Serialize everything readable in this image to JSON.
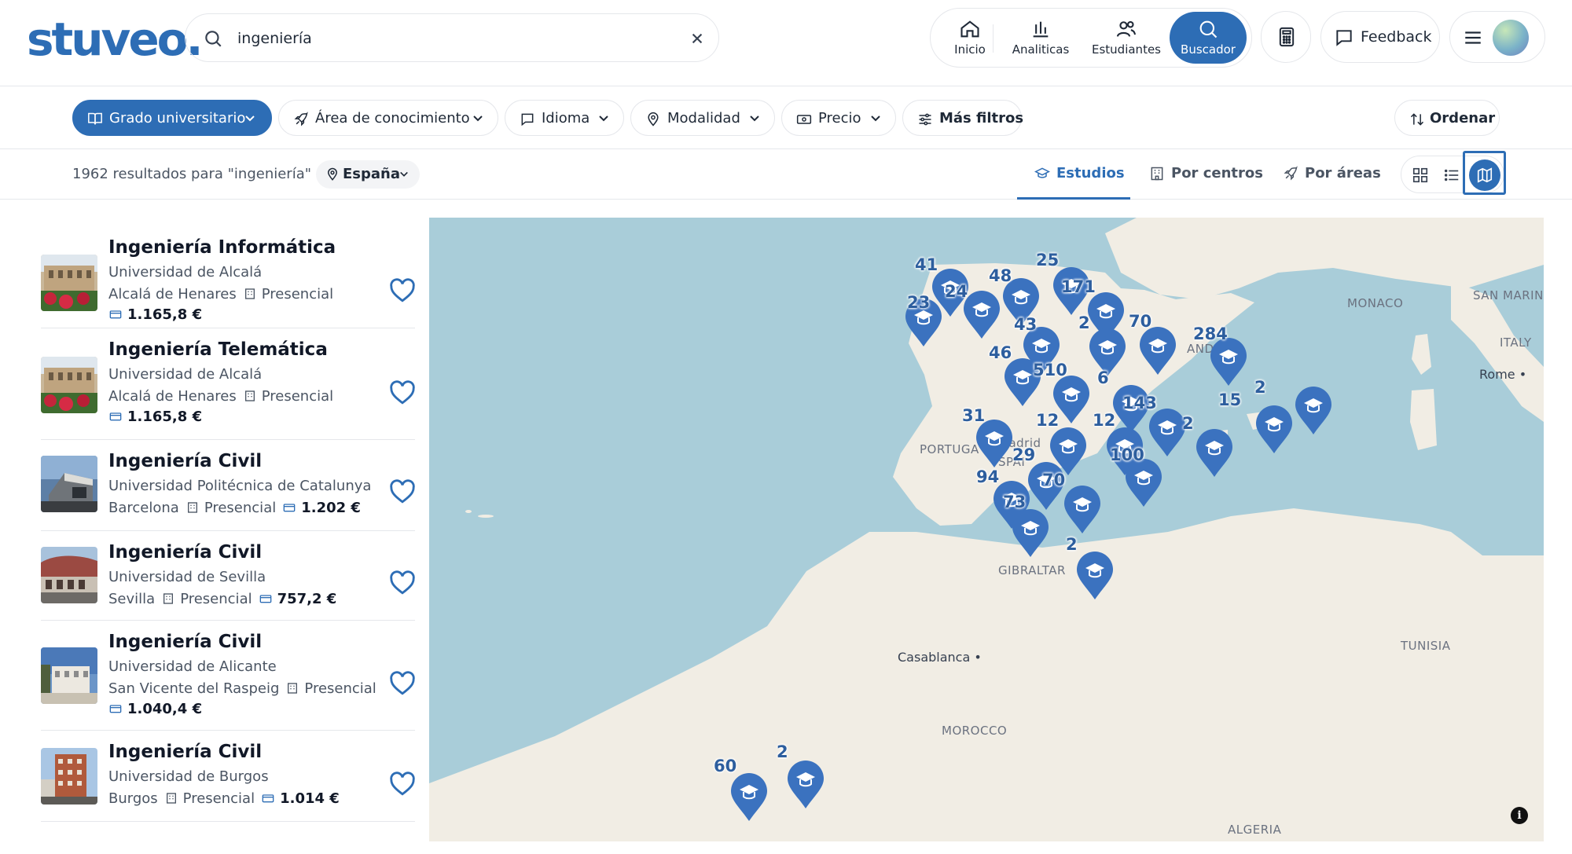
{
  "brand": {
    "logo": "stuveo.",
    "color": "#2d6db5"
  },
  "search": {
    "value": "ingeniería",
    "placeholder": ""
  },
  "nav": {
    "inicio": "Inicio",
    "analiticas": "Analiticas",
    "estudiantes": "Estudiantes",
    "buscador": "Buscador",
    "feedback": "Feedback"
  },
  "filters": {
    "grado": "Grado universitario",
    "area": "Área de conocimiento",
    "idioma": "Idioma",
    "modalidad": "Modalidad",
    "precio": "Precio",
    "mas_filtros": "Más filtros",
    "ordenar": "Ordenar"
  },
  "results": {
    "count_text": "1962 resultados para \"ingeniería\" en",
    "country": "España",
    "tabs": {
      "estudios": "Estudios",
      "centros": "Por centros",
      "areas": "Por áreas"
    }
  },
  "cards": [
    {
      "title": "Ingeniería Informática",
      "university": "Universidad de Alcalá",
      "city": "Alcalá de Henares",
      "mode": "Presencial",
      "price": "1.165,8 €"
    },
    {
      "title": "Ingeniería Telemática",
      "university": "Universidad de Alcalá",
      "city": "Alcalá de Henares",
      "mode": "Presencial",
      "price": "1.165,8 €"
    },
    {
      "title": "Ingeniería Civil",
      "university": "Universidad Politécnica de Catalunya",
      "city": "Barcelona",
      "mode": "Presencial",
      "price": "1.202 €"
    },
    {
      "title": "Ingeniería Civil",
      "university": "Universidad de Sevilla",
      "city": "Sevilla",
      "mode": "Presencial",
      "price": "757,2 €"
    },
    {
      "title": "Ingeniería Civil",
      "university": "Universidad de Alicante",
      "city": "San Vicente del Raspeig",
      "mode": "Presencial",
      "price": "1.040,4 €"
    },
    {
      "title": "Ingeniería Civil",
      "university": "Universidad de Burgos",
      "city": "Burgos",
      "mode": "Presencial",
      "price": "1.014 €"
    }
  ],
  "map": {
    "regions": {
      "monaco": "MONACO",
      "san_marino": "SAN MARINO",
      "italy": "ITALY",
      "portugal": "PORTUGA",
      "gibraltar": "GIBRALTAR",
      "tunisia": "TUNISIA",
      "morocco": "MOROCCO",
      "algeria": "ALGERIA",
      "andorra": "ANDO",
      "madrid": "Madrid",
      "spain": "SPAI"
    },
    "cities": {
      "rome": "Rome",
      "casablanca": "Casablanca"
    },
    "cluster_counts": [
      "41",
      "48",
      "25",
      "23",
      "24",
      "171",
      "43",
      "2",
      "70",
      "284",
      "46",
      "510",
      "6",
      "2",
      "15",
      "31",
      "12",
      "12",
      "143",
      "2",
      "29",
      "100",
      "94",
      "70",
      "73",
      "2",
      "60",
      "2"
    ],
    "info": "i"
  }
}
